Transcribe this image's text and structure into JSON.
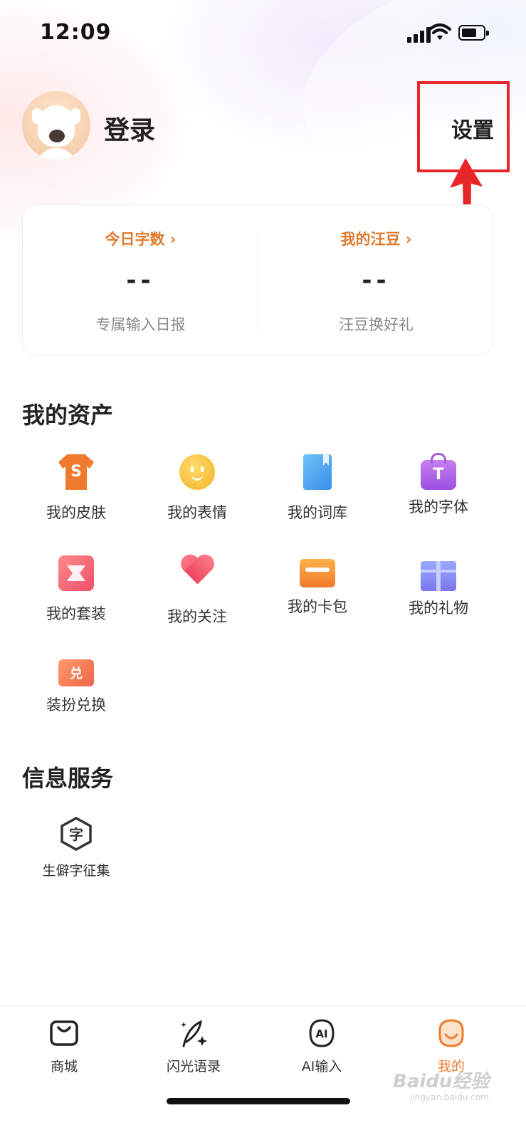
{
  "status": {
    "time": "12:09"
  },
  "header": {
    "login": "登录",
    "settings": "设置"
  },
  "stats": {
    "left": {
      "link": "今日字数 ›",
      "value": "--",
      "sub": "专属输入日报"
    },
    "right": {
      "link": "我的汪豆 ›",
      "value": "--",
      "sub": "汪豆换好礼"
    }
  },
  "assets": {
    "title": "我的资产",
    "items": [
      {
        "label": "我的皮肤",
        "icon": "shirt-icon"
      },
      {
        "label": "我的表情",
        "icon": "smile-icon"
      },
      {
        "label": "我的词库",
        "icon": "book-icon"
      },
      {
        "label": "我的字体",
        "icon": "font-bag-icon"
      },
      {
        "label": "我的套装",
        "icon": "suit-icon"
      },
      {
        "label": "我的关注",
        "icon": "heart-icon"
      },
      {
        "label": "我的卡包",
        "icon": "card-icon"
      },
      {
        "label": "我的礼物",
        "icon": "gift-icon"
      },
      {
        "label": "装扮兑换",
        "icon": "ticket-icon"
      }
    ]
  },
  "services": {
    "title": "信息服务",
    "items": [
      {
        "label": "生僻字征集",
        "icon": "hexagon-char-icon"
      }
    ]
  },
  "nav": {
    "items": [
      {
        "label": "商城",
        "icon": "shop-bag-icon"
      },
      {
        "label": "闪光语录",
        "icon": "feather-sparkle-icon"
      },
      {
        "label": "AI输入",
        "icon": "ai-icon"
      },
      {
        "label": "我的",
        "icon": "profile-face-icon"
      }
    ],
    "active_index": 3
  },
  "watermark": {
    "brand": "Baidu经验",
    "url": "jingyan.baidu.com"
  },
  "colors": {
    "accent": "#f07b2e",
    "annotation": "#e8262a"
  }
}
